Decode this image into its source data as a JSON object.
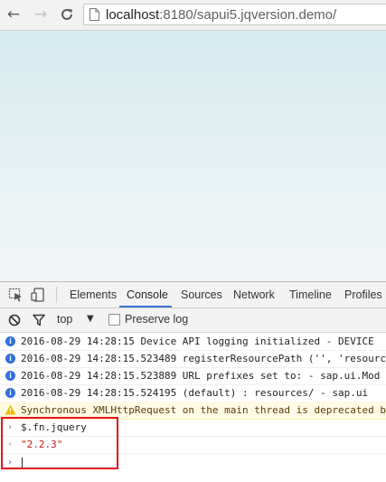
{
  "browser": {
    "url_host": "localhost",
    "url_rest": ":8180/sapui5.jqversion.demo/"
  },
  "devtools": {
    "tabs": [
      {
        "label": "Elements",
        "active": false
      },
      {
        "label": "Console",
        "active": true
      },
      {
        "label": "Sources",
        "active": false
      },
      {
        "label": "Network",
        "active": false
      },
      {
        "label": "Timeline",
        "active": false
      },
      {
        "label": "Profiles",
        "active": false
      }
    ],
    "filter": {
      "context": "top",
      "preserve_log_label": "Preserve log",
      "preserve_log_checked": false
    },
    "console": {
      "messages": [
        {
          "level": "info",
          "text": "2016-08-29 14:28:15 Device API logging initialized - DEVICE"
        },
        {
          "level": "info",
          "text": "2016-08-29 14:28:15.523489 registerResourcePath ('', 'resourc"
        },
        {
          "level": "info",
          "text": "2016-08-29 14:28:15.523889 URL prefixes set to: -  sap.ui.Mod"
        },
        {
          "level": "info",
          "text": "2016-08-29 14:28:15.524195  (default) : resources/ -  sap.ui"
        },
        {
          "level": "warning",
          "text": "Synchronous XMLHttpRequest on the main thread is deprecated b"
        }
      ],
      "command": "$.fn.jquery",
      "result": "\"2.2.3\""
    }
  },
  "colors": {
    "accent_tab": "#3879d9",
    "info_icon": "#2f6fde",
    "warning_bg": "#fffbe5",
    "result_string": "#c41a16",
    "highlight_box": "#e2161d"
  },
  "icons": {
    "back": "arrow-left-icon",
    "forward": "arrow-right-icon",
    "reload": "reload-icon",
    "page": "page-icon",
    "inspect": "inspect-element-icon",
    "device": "device-mode-icon",
    "clear": "clear-console-icon",
    "filter": "filter-icon"
  }
}
